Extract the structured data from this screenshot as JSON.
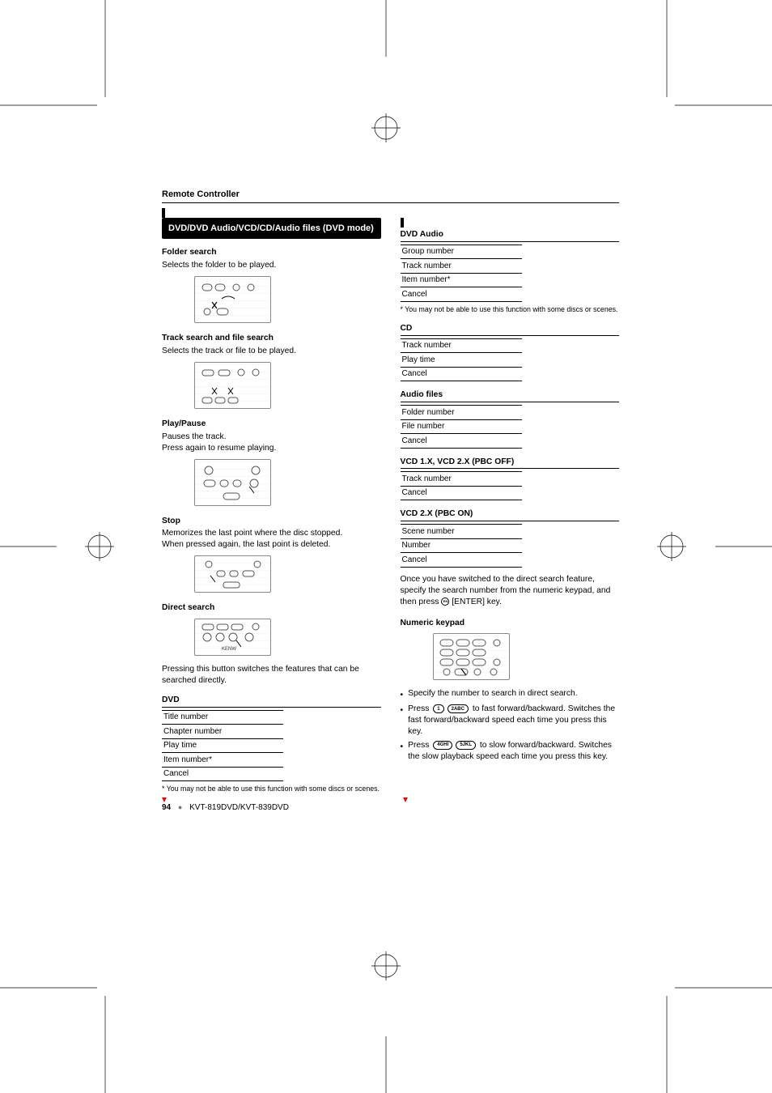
{
  "header": {
    "title": "Remote Controller"
  },
  "titleBar": "DVD/DVD Audio/VCD/CD/Audio files (DVD mode)",
  "left": {
    "folder": {
      "head": "Folder search",
      "desc": "Selects the folder to be played."
    },
    "track": {
      "head": "Track search and file search",
      "desc": "Selects the track or file to be played."
    },
    "play": {
      "head": "Play/Pause",
      "l1": "Pauses the track.",
      "l2": "Press again to resume playing."
    },
    "stop": {
      "head": "Stop",
      "l1": "Memorizes the last point where the disc stopped.",
      "l2": "When pressed again, the last point is deleted."
    },
    "direct": {
      "head": "Direct search",
      "desc": "Pressing this button switches the features that can be searched directly."
    },
    "dvd": {
      "head": "DVD",
      "rows": [
        "Title number",
        "Chapter number",
        "Play time",
        "Item number*",
        "Cancel"
      ]
    },
    "note": "* You may not be able to use this function with some discs or scenes."
  },
  "right": {
    "dvdaudio": {
      "head": "DVD Audio",
      "rows": [
        "Group number",
        "Track number",
        "Item number*",
        "Cancel"
      ]
    },
    "note1": "* You may not be able to use this function with some discs or scenes.",
    "cd": {
      "head": "CD",
      "rows": [
        "Track number",
        "Play time",
        "Cancel"
      ]
    },
    "audio": {
      "head": "Audio files",
      "rows": [
        "Folder number",
        "File number",
        "Cancel"
      ]
    },
    "vcd1": {
      "head": "VCD 1.X, VCD 2.X (PBC OFF)",
      "rows": [
        "Track number",
        "Cancel"
      ]
    },
    "vcd2": {
      "head": "VCD 2.X (PBC ON)",
      "rows": [
        "Scene number",
        "Number",
        "Cancel"
      ]
    },
    "switch": "Once you have switched to the direct search feature, specify the search number from the numeric keypad, and then press ",
    "switch_tail": " [ENTER] key.",
    "numeric": {
      "head": "Numeric keypad"
    },
    "bullets": {
      "b1": "Specify the number to search in direct search.",
      "b2a": "Press ",
      "b2b": " to fast forward/backward. Switches the fast forward/backward speed each time you press this key.",
      "b3a": "Press ",
      "b3b": " to slow forward/backward. Switches the slow playback speed each time you press this key."
    },
    "keys": {
      "k1": "1",
      "k2": "2ABC",
      "k4": "4GHI",
      "k5": "5JKL"
    }
  },
  "footer": {
    "page": "94",
    "model": "KVT-819DVD/KVT-839DVD"
  }
}
